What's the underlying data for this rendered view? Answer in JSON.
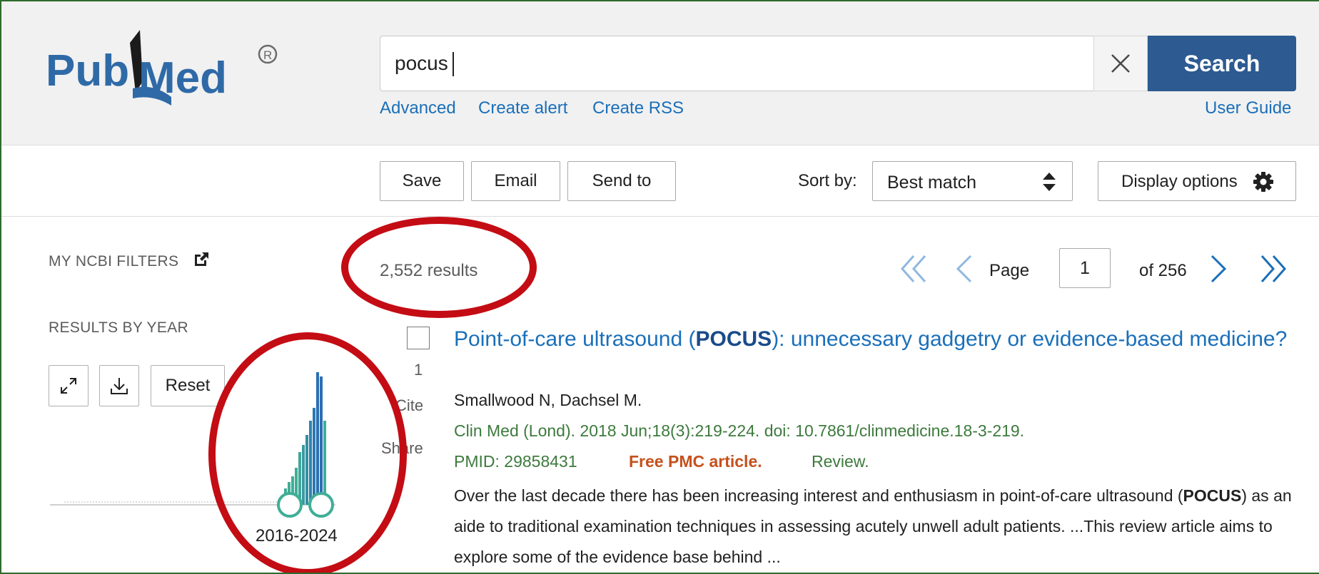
{
  "logo": {
    "text": "PubMed",
    "mark": "®"
  },
  "search": {
    "value": "pocus",
    "button_label": "Search",
    "links": [
      "Advanced",
      "Create alert",
      "Create RSS"
    ],
    "user_guide": "User Guide"
  },
  "toolbar": {
    "save": "Save",
    "email": "Email",
    "send_to": "Send to",
    "sort_label": "Sort by:",
    "sort_value": "Best match",
    "display_options": "Display options"
  },
  "sidebar": {
    "my_filters": "MY NCBI FILTERS",
    "results_by_year": "RESULTS BY YEAR",
    "reset": "Reset",
    "year_range": "2016-2024",
    "timeline_icons": [
      "expand-icon",
      "download-icon",
      "external-link-icon"
    ]
  },
  "results": {
    "count": "2,552 results",
    "page_label": "Page",
    "page_value": "1",
    "page_of": "of 256"
  },
  "article": {
    "number": "1",
    "cite": "Cite",
    "share": "Share",
    "title_before": "Point-of-care ultrasound (",
    "title_bold": "POCUS",
    "title_after": "): unnecessary gadgetry or evidence-based medicine?",
    "authors": "Smallwood N, Dachsel M.",
    "journal": "Clin Med (Lond). 2018 Jun;18(3):219-224. doi: 10.7861/clinmedicine.18-3-219.",
    "pmid": "PMID: 29858431",
    "free": "Free PMC article.",
    "review": "Review.",
    "snippet_1": "Over the last decade there has been increasing interest and enthusiasm in point-of-care ultrasound (",
    "snippet_bold": "POCUS",
    "snippet_2": ") as an aide to traditional examination techniques in assessing acutely unwell adult patients. ...This review article aims to explore some of the evidence base behind ..."
  },
  "colors": {
    "brand_blue": "#2c5a91",
    "link_blue": "#1a6fb9",
    "journal_green": "#3d7a3d",
    "free_orange": "#c4511d",
    "annotation_red": "#c40c14",
    "bar_teal": "#3fae96"
  }
}
